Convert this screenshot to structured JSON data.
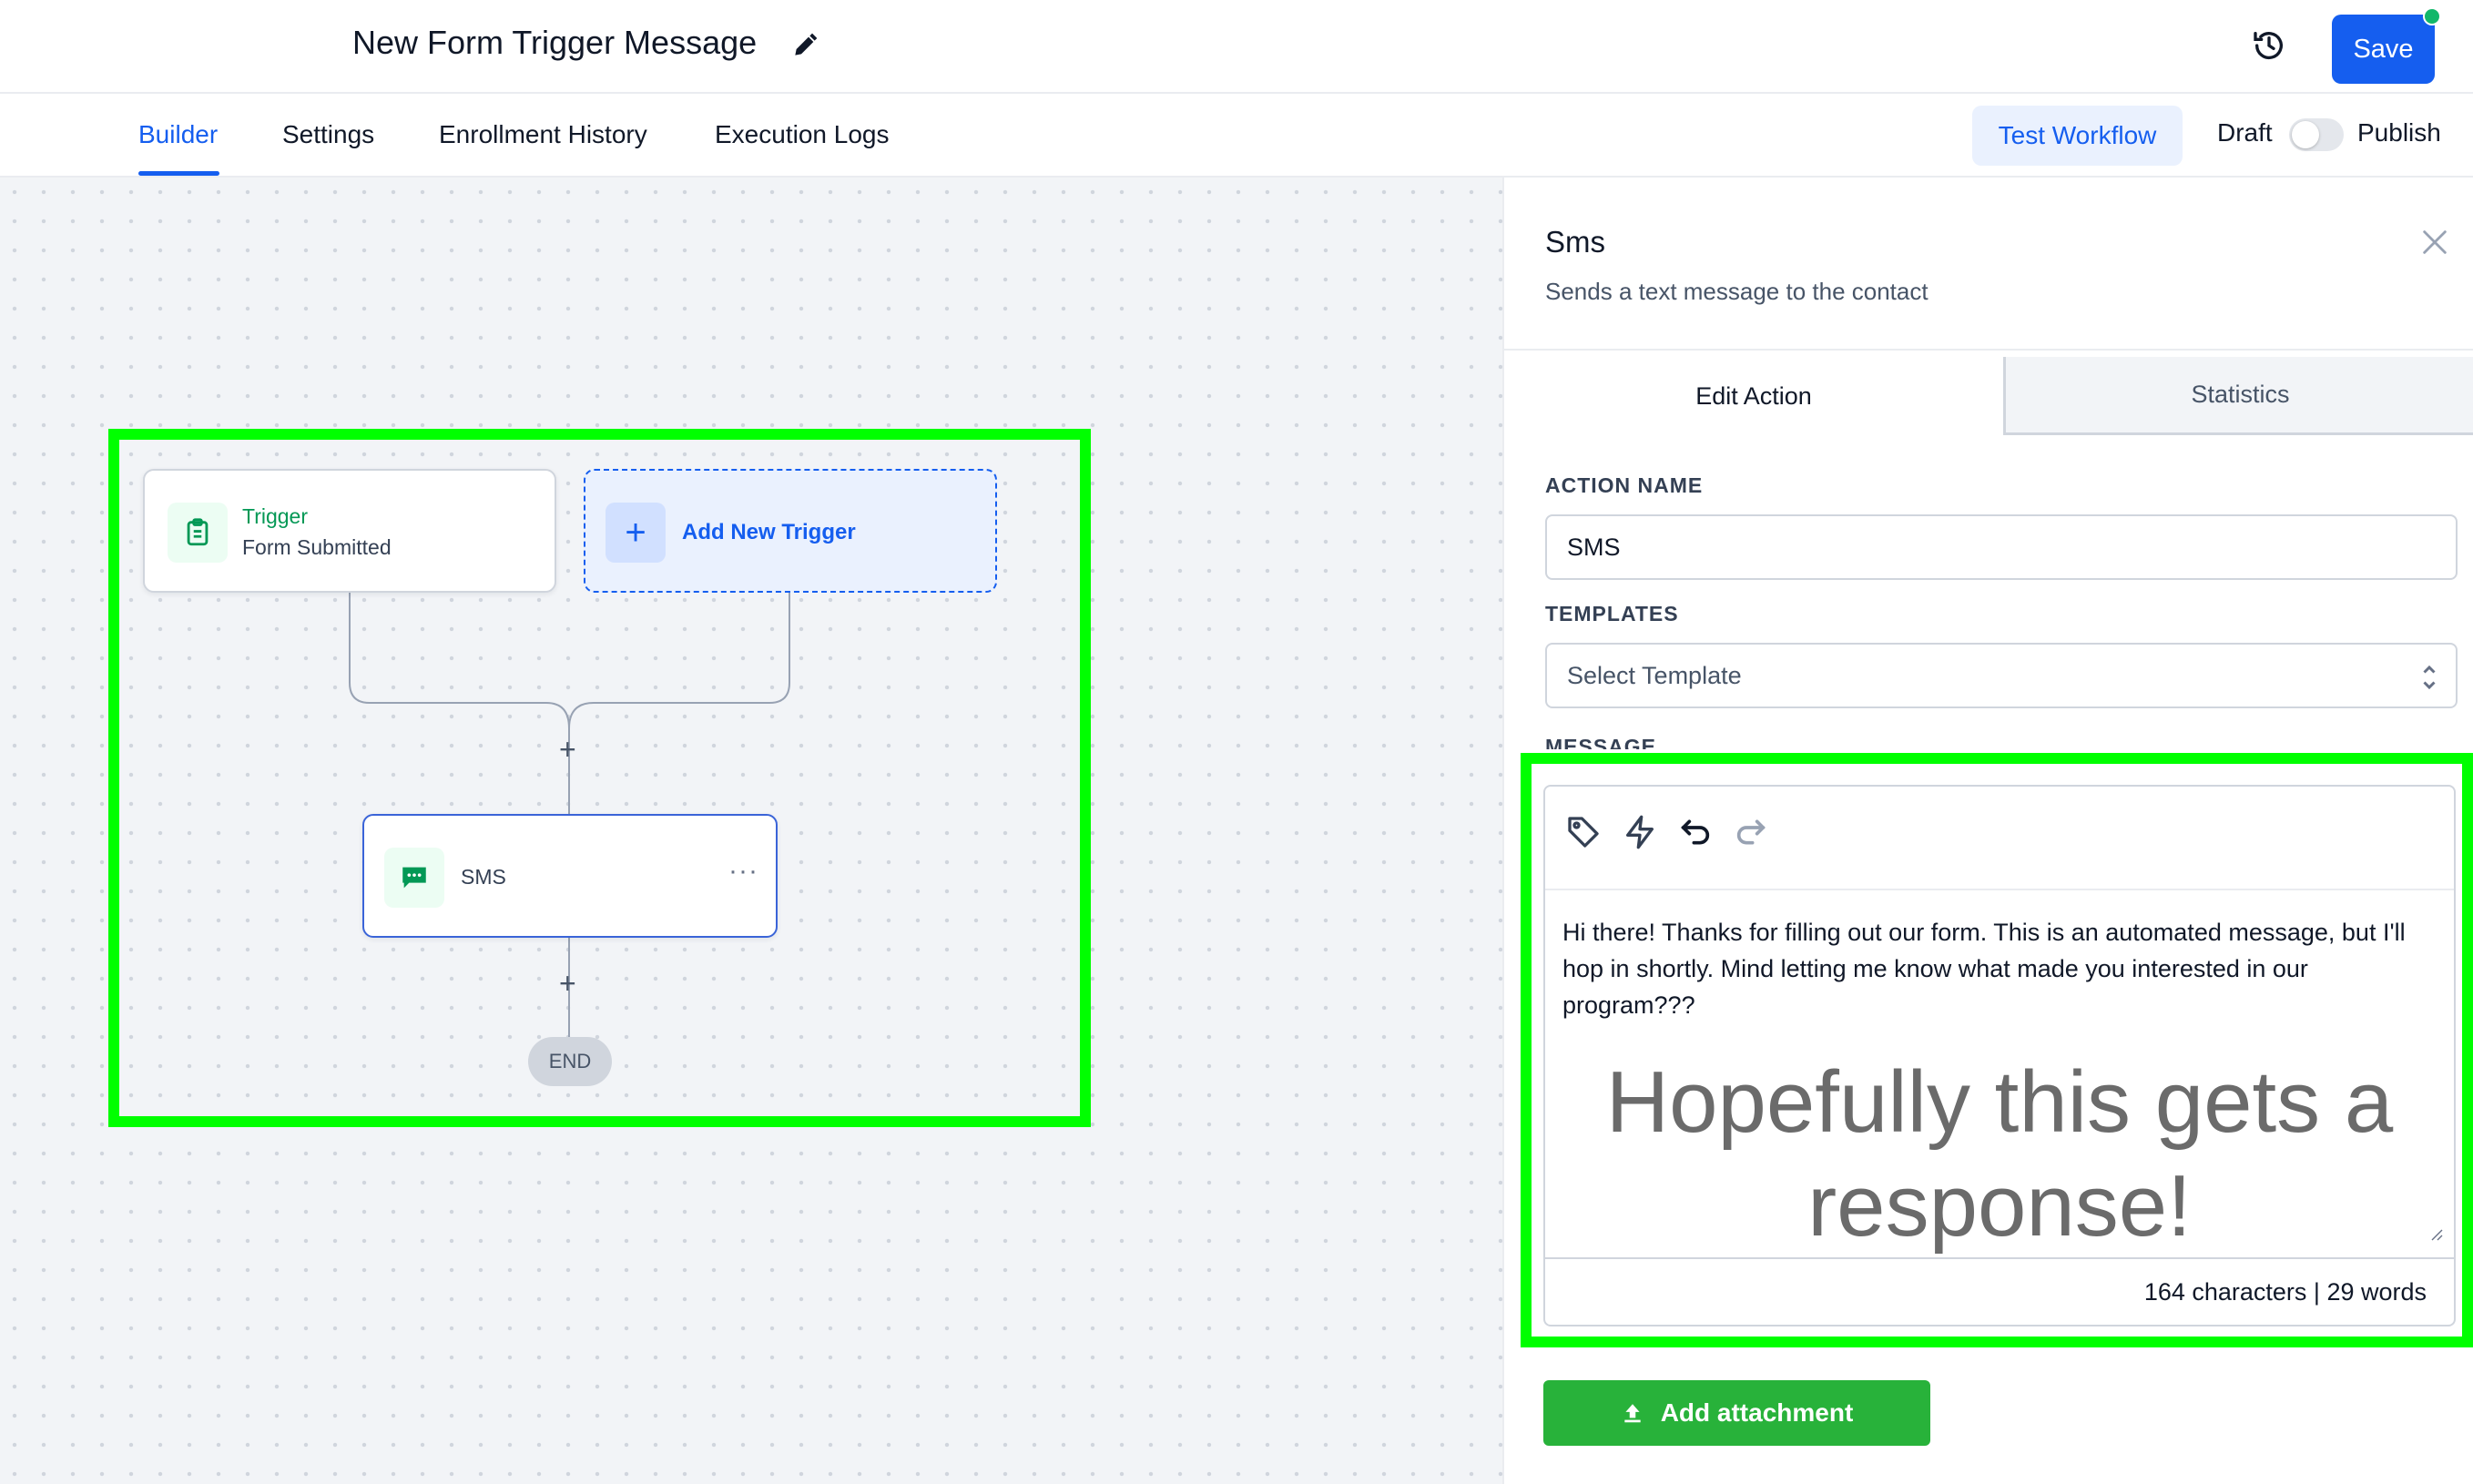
{
  "header": {
    "workflow_title": "New Form Trigger Message",
    "save_label": "Save"
  },
  "nav": {
    "tabs": [
      "Builder",
      "Settings",
      "Enrollment History",
      "Execution Logs"
    ],
    "active_tab": "Builder",
    "test_workflow_label": "Test Workflow",
    "draft_label": "Draft",
    "publish_label": "Publish",
    "published": false
  },
  "canvas": {
    "trigger": {
      "label": "Trigger",
      "subtitle": "Form Submitted"
    },
    "add_trigger_label": "Add New Trigger",
    "action": {
      "label": "SMS"
    },
    "end_label": "END"
  },
  "panel": {
    "title": "Sms",
    "subtitle": "Sends a text message to the contact",
    "tabs": {
      "edit": "Edit Action",
      "stats": "Statistics"
    },
    "action_name_label": "ACTION NAME",
    "action_name_value": "SMS",
    "templates_label": "TEMPLATES",
    "template_placeholder": "Select Template",
    "message_label": "MESSAGE",
    "message_text": "Hi there!  Thanks for filling out our form.  This is an automated message, but I'll hop in shortly.  Mind letting me know what made you interested in our program???",
    "message_large_text": "Hopefully this gets a response!",
    "count_text": "164 characters | 29 words",
    "attach_label": "Add attachment"
  },
  "colors": {
    "accent": "#155eef",
    "highlight": "#00ff00",
    "attach_button": "#28b23a"
  }
}
